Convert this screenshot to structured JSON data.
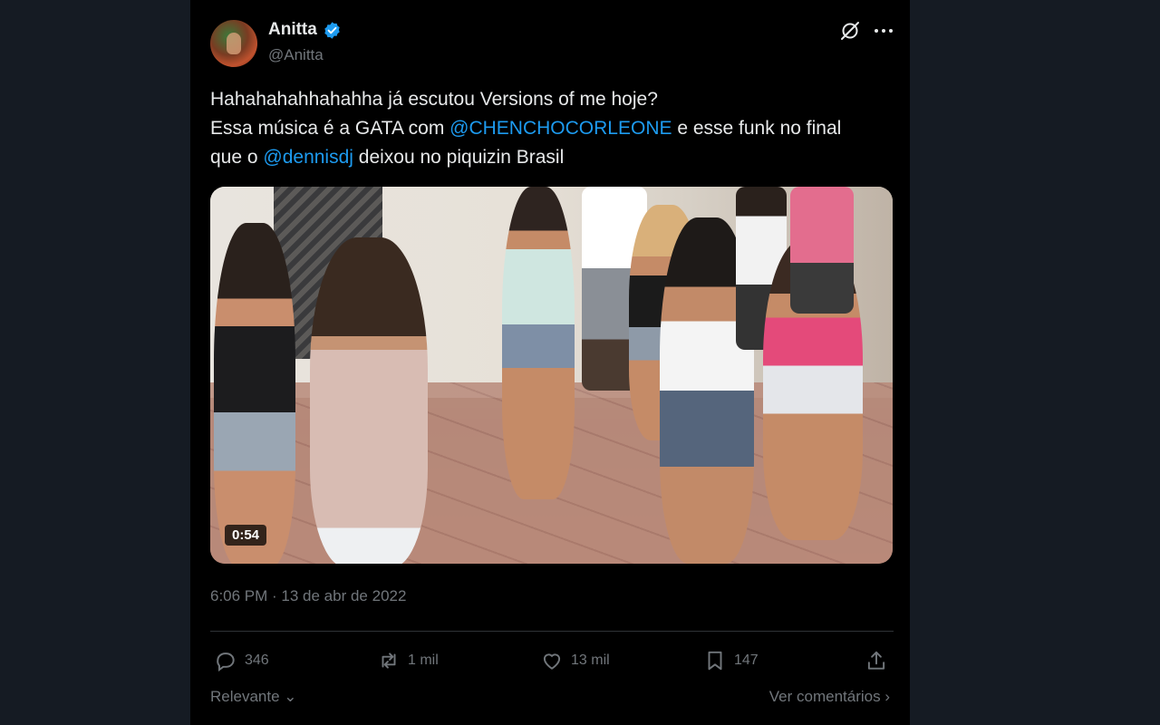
{
  "author": {
    "display_name": "Anitta",
    "handle": "@Anitta",
    "verified_icon": "verified-badge-icon"
  },
  "tweet": {
    "line1": "Hahahahahhahahha já escutou Versions of me hoje?",
    "line2_pre": "Essa música é a GATA com ",
    "mention1": "@CHENCHOCORLEONE",
    "line2_post": " e esse funk no final",
    "line3_pre": "que o ",
    "mention2": "@dennisdj",
    "line3_post": " deixou no piquizin Brasil"
  },
  "media": {
    "duration": "0:54"
  },
  "timestamp": "6:06 PM · 13 de abr de 2022",
  "actions": {
    "replies": "346",
    "reposts": "1 mil",
    "likes": "13 mil",
    "bookmarks": "147"
  },
  "footer": {
    "sort_label": "Relevante",
    "view_comments": "Ver comentários"
  },
  "colors": {
    "accent": "#1d9bf0",
    "muted": "#71767b",
    "background": "#000000"
  }
}
